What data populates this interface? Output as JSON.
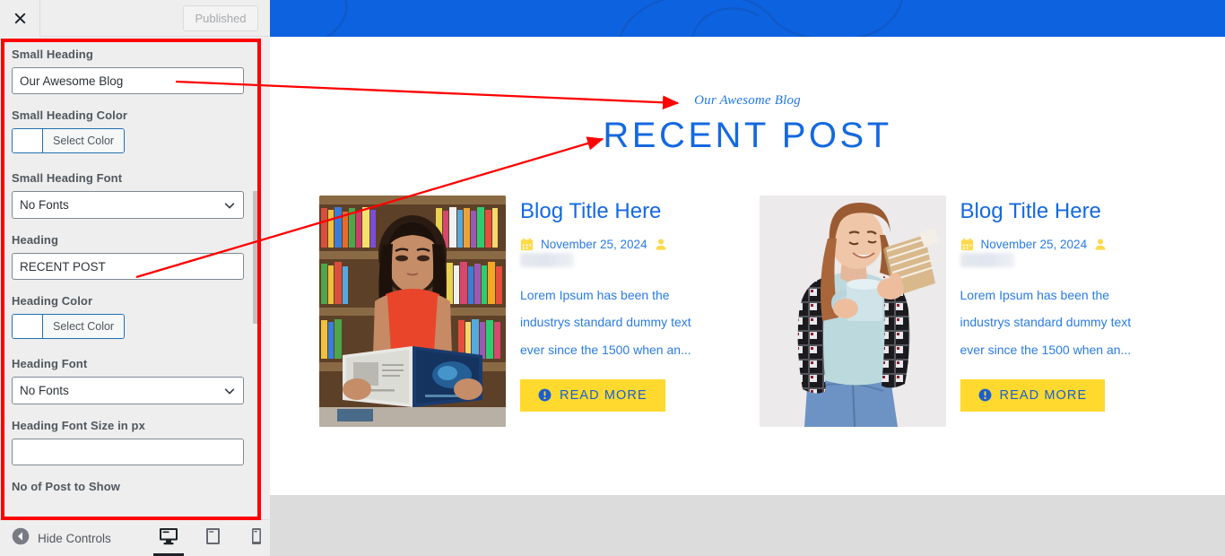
{
  "customizer": {
    "header": {
      "close_icon": "close-icon",
      "publish_label": "Published"
    },
    "fields": [
      {
        "label": "Small Heading",
        "type": "text",
        "value": "Our Awesome Blog"
      },
      {
        "label": "Small Heading Color",
        "type": "color",
        "button_label": "Select Color",
        "swatch": "#ffffff"
      },
      {
        "label": "Small Heading Font",
        "type": "select",
        "value": "No Fonts"
      },
      {
        "label": "Heading",
        "type": "text",
        "value": "RECENT POST"
      },
      {
        "label": "Heading Color",
        "type": "color",
        "button_label": "Select Color",
        "swatch": "#ffffff"
      },
      {
        "label": "Heading Font",
        "type": "select",
        "value": "No Fonts"
      },
      {
        "label": "Heading Font Size in px",
        "type": "text",
        "value": ""
      },
      {
        "label": "No of Post to Show",
        "type": "text",
        "value": ""
      }
    ],
    "footer": {
      "hide_controls_label": "Hide Controls",
      "back_icon": "back-arrow-icon",
      "devices": [
        {
          "name": "desktop",
          "icon": "desktop-icon",
          "active": true
        },
        {
          "name": "tablet",
          "icon": "tablet-icon",
          "active": false
        },
        {
          "name": "mobile",
          "icon": "mobile-icon",
          "active": false
        }
      ]
    }
  },
  "preview": {
    "banner_color": "#0d62e0",
    "small_heading": "Our Awesome Blog",
    "heading": "RECENT POST",
    "heading_color": "#1569e0",
    "accent_yellow": "#ffd92e",
    "cards": [
      {
        "image_alt": "woman-reading-book-in-library",
        "title": "Blog Title Here",
        "date": "November 25, 2024",
        "calendar_icon": "calendar-icon",
        "author_icon": "user-icon",
        "excerpt": "Lorem Ipsum has been the industrys standard dummy text ever since the 1500 when an...",
        "button_label": "READ MORE",
        "button_icon": "info-circle-icon"
      },
      {
        "image_alt": "woman-with-plaid-shirt-reading-book-holding-mug",
        "title": "Blog Title Here",
        "date": "November 25, 2024",
        "calendar_icon": "calendar-icon",
        "author_icon": "user-icon",
        "excerpt": "Lorem Ipsum has been the industrys standard dummy text ever since the 1500 when an...",
        "button_label": "READ MORE",
        "button_icon": "info-circle-icon"
      }
    ]
  },
  "annotations": {
    "highlight_color": "#ff0000",
    "arrows": [
      {
        "from": "small-heading-input",
        "to": "preview-small-heading"
      },
      {
        "from": "heading-input",
        "to": "preview-heading"
      }
    ]
  }
}
